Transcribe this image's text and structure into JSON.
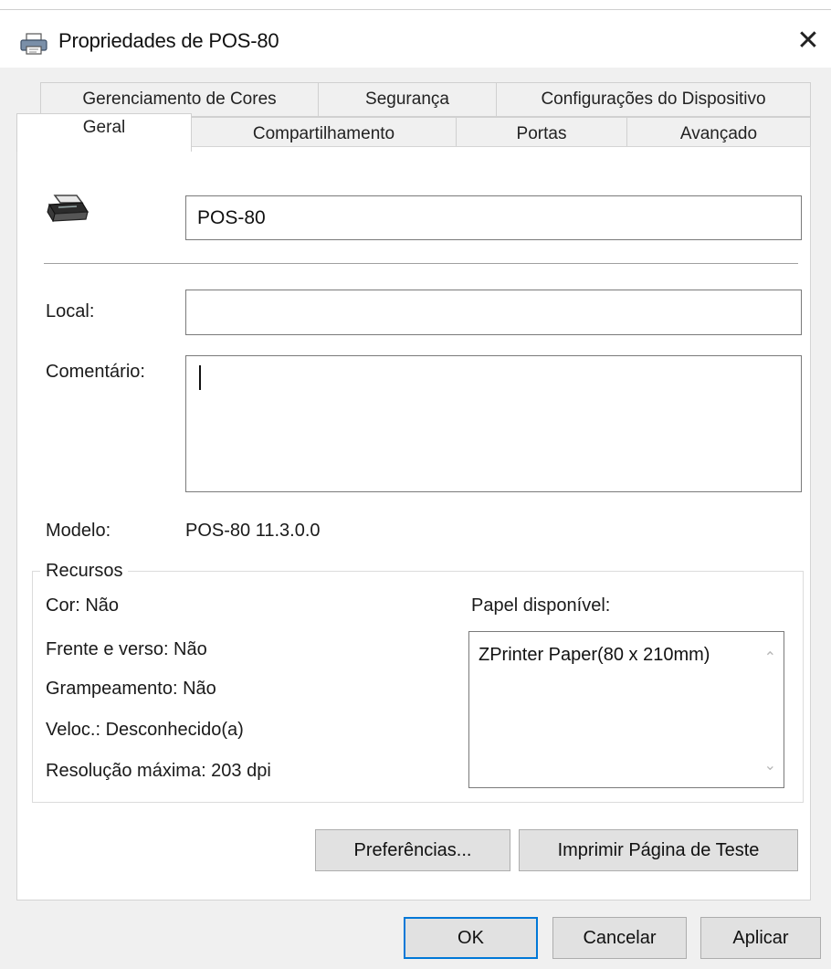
{
  "window": {
    "title": "Propriedades de POS-80",
    "close_symbol": "✕"
  },
  "tabs_row1": [
    {
      "label": "Gerenciamento de Cores"
    },
    {
      "label": "Segurança"
    },
    {
      "label": "Configurações do Dispositivo"
    }
  ],
  "tabs_row2": [
    {
      "label": "Geral",
      "selected": true
    },
    {
      "label": "Compartilhamento"
    },
    {
      "label": "Portas"
    },
    {
      "label": "Avançado"
    }
  ],
  "general": {
    "printer_name": "POS-80",
    "local_label": "Local:",
    "local_value": "",
    "comment_label": "Comentário:",
    "comment_value": "",
    "model_label": "Modelo:",
    "model_value": "POS-80 11.3.0.0"
  },
  "resources": {
    "legend": "Recursos",
    "color": "Cor: Não",
    "duplex": "Frente e verso: Não",
    "stapling": "Grampeamento: Não",
    "speed": "Veloc.: Desconhecido(a)",
    "max_resolution": "Resolução máxima: 203 dpi",
    "paper_label": "Papel disponível:",
    "paper_items": [
      "ZPrinter Paper(80 x 210mm)"
    ]
  },
  "buttons": {
    "preferences": "Preferências...",
    "print_test": "Imprimir Página de Teste",
    "ok": "OK",
    "cancel": "Cancelar",
    "apply": "Aplicar"
  },
  "colors": {
    "accent": "#0078d7",
    "dialog_bg": "#f0f0f0"
  }
}
